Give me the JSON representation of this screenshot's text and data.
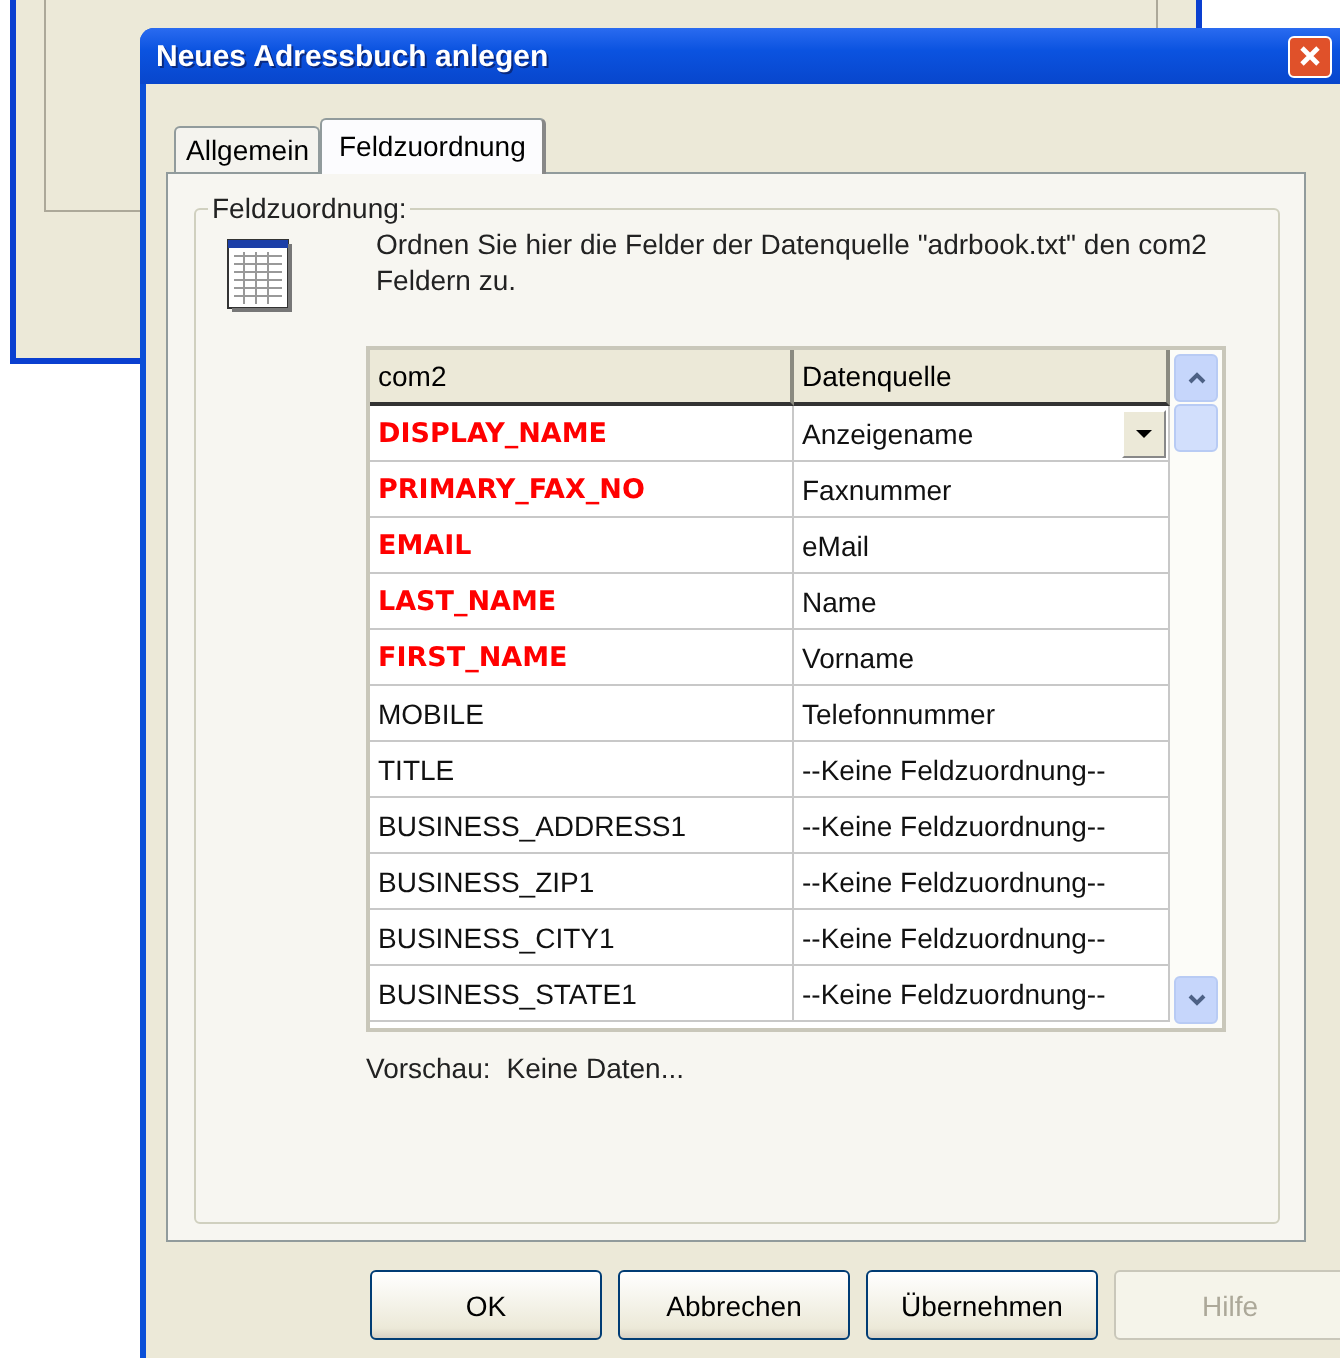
{
  "window": {
    "title": "Neues Adressbuch anlegen"
  },
  "tabs": [
    {
      "label": "Allgemein",
      "selected": false
    },
    {
      "label": "Feldzuordnung",
      "selected": true
    }
  ],
  "group": {
    "label": "Feldzuordnung:",
    "description": "Ordnen Sie hier die Felder der Datenquelle \"adrbook.txt\" den com2 Feldern zu."
  },
  "table": {
    "columns": [
      "com2",
      "Datenquelle"
    ],
    "rows": [
      {
        "field": "DISPLAY_NAME",
        "source": "Anzeigename",
        "required": true,
        "editing": true
      },
      {
        "field": "PRIMARY_FAX_NO",
        "source": "Faxnummer",
        "required": true,
        "editing": false
      },
      {
        "field": "EMAIL",
        "source": "eMail",
        "required": true,
        "editing": false
      },
      {
        "field": "LAST_NAME",
        "source": "Name",
        "required": true,
        "editing": false
      },
      {
        "field": "FIRST_NAME",
        "source": "Vorname",
        "required": true,
        "editing": false
      },
      {
        "field": "MOBILE",
        "source": "Telefonnummer",
        "required": false,
        "editing": false
      },
      {
        "field": "TITLE",
        "source": "--Keine Feldzuordnung--",
        "required": false,
        "editing": false
      },
      {
        "field": "BUSINESS_ADDRESS1",
        "source": "--Keine Feldzuordnung--",
        "required": false,
        "editing": false
      },
      {
        "field": "BUSINESS_ZIP1",
        "source": "--Keine Feldzuordnung--",
        "required": false,
        "editing": false
      },
      {
        "field": "BUSINESS_CITY1",
        "source": "--Keine Feldzuordnung--",
        "required": false,
        "editing": false
      },
      {
        "field": "BUSINESS_STATE1",
        "source": "--Keine Feldzuordnung--",
        "required": false,
        "editing": false
      }
    ]
  },
  "preview": {
    "label": "Vorschau:",
    "value": "Keine Daten..."
  },
  "buttons": [
    {
      "label": "OK",
      "disabled": false
    },
    {
      "label": "Abbrechen",
      "disabled": false
    },
    {
      "label": "Übernehmen",
      "disabled": false
    },
    {
      "label": "Hilfe",
      "disabled": true
    }
  ]
}
